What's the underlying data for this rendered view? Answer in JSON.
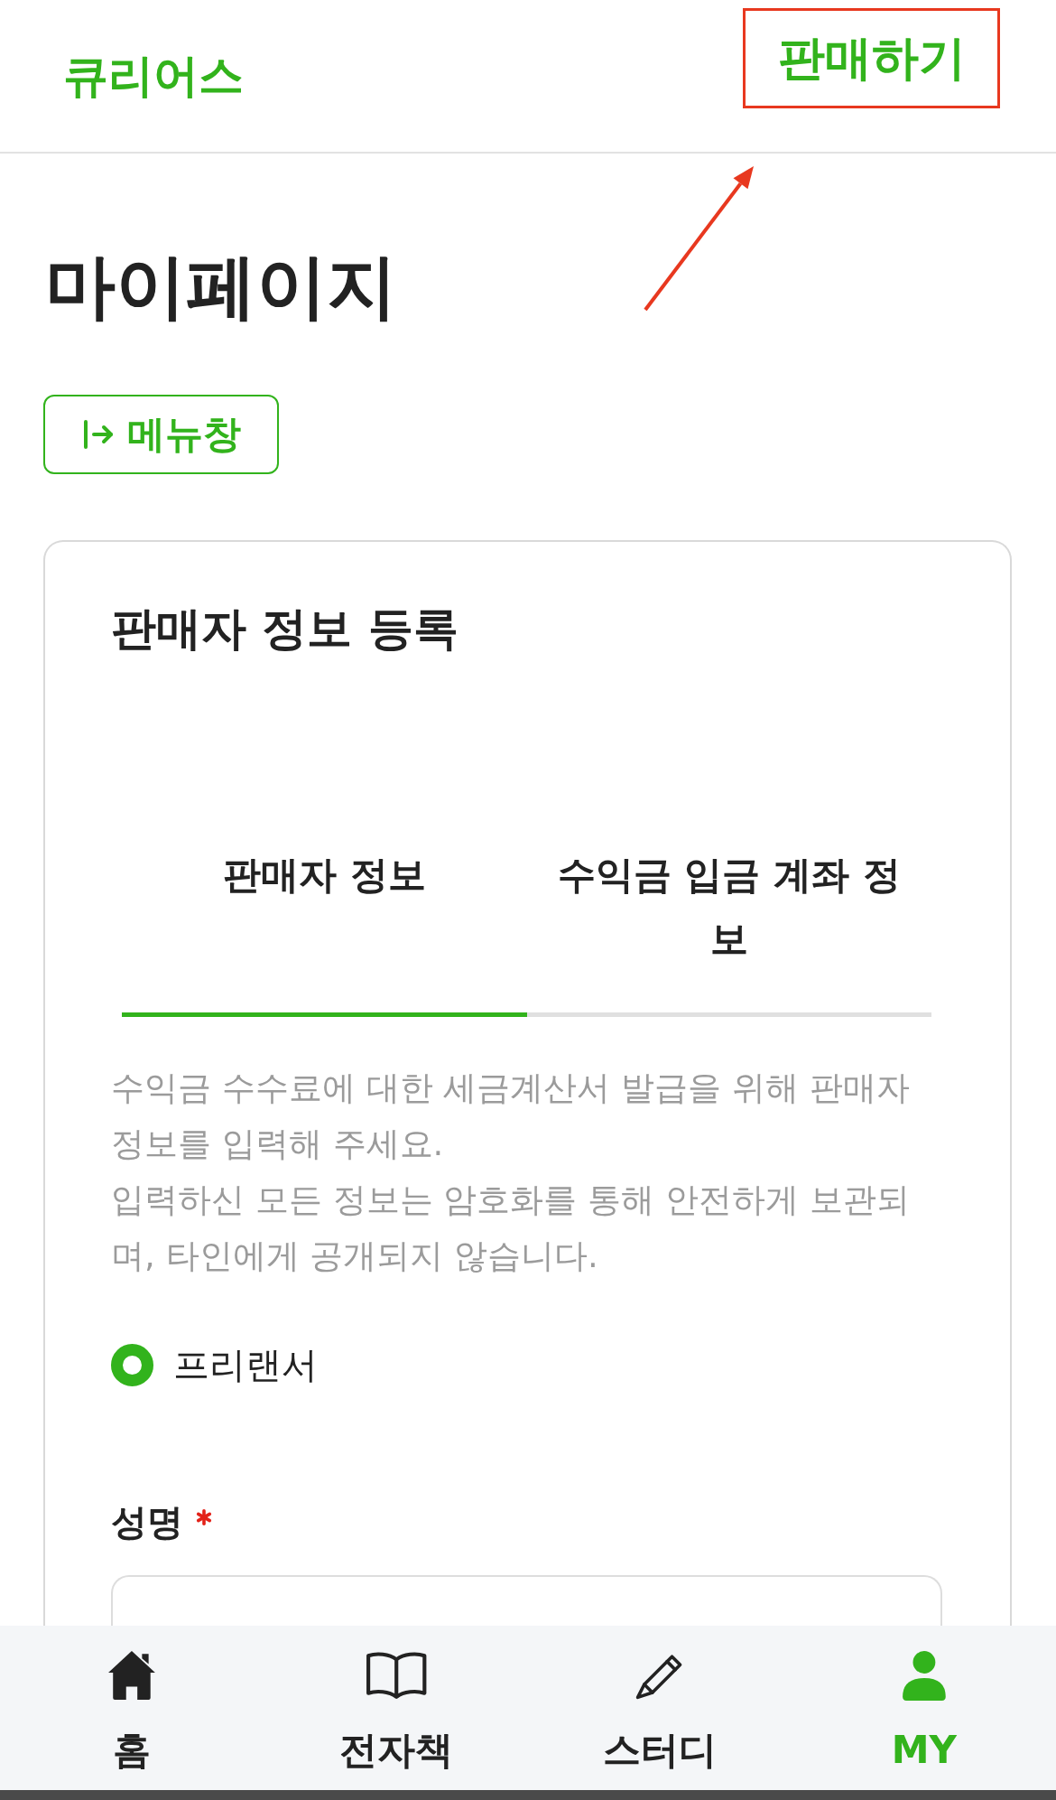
{
  "header": {
    "logo": "큐리어스",
    "sell_button": {
      "label": "판매하기",
      "highlighted": true
    }
  },
  "page": {
    "title": "마이페이지",
    "menu_button": {
      "label": "메뉴창"
    }
  },
  "card": {
    "title": "판매자 정보 등록",
    "tabs": [
      {
        "label": "판매자 정보",
        "selected": true
      },
      {
        "label": "수익금 입금 계좌 정보",
        "selected": false
      }
    ],
    "description": [
      "수익금 수수료에 대한 세금계산서 발급을 위해 판매자 정보를 입력해 주세요.",
      "입력하신 모든 정보는 암호화를 통해 안전하게 보관되며, 타인에게 공개되지 않습니다."
    ],
    "seller_types": [
      {
        "label": "프리랜서",
        "selected": true
      }
    ],
    "fields": [
      {
        "label": "성명",
        "required": true
      }
    ]
  },
  "bottom_nav": [
    {
      "label": "홈",
      "kind": "home",
      "selected": false
    },
    {
      "label": "전자책",
      "kind": "ebook",
      "selected": false
    },
    {
      "label": "스터디",
      "kind": "study",
      "selected": false
    },
    {
      "label": "MY",
      "kind": "my",
      "selected": true
    }
  ]
}
